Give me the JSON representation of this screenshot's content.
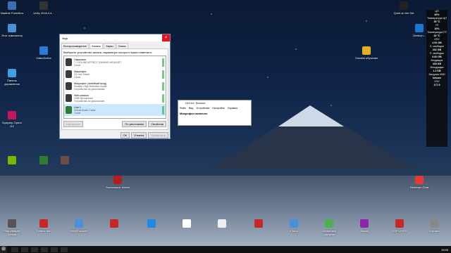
{
  "desktop": {
    "icons": [
      {
        "label": "Vladimir Pomelkov",
        "color": "#3b6fb5"
      },
      {
        "label": "Unity 2018.4.4...",
        "color": "#333"
      },
      {
        "label": "Этот компьютер",
        "color": "#4a90d9"
      },
      {
        "label": "VideoScribe",
        "color": "#2d7ad6"
      },
      {
        "label": "Панель управления",
        "color": "#3fa0e0"
      },
      {
        "label": "Браузер Opera GX",
        "color": "#c2185b"
      },
      {
        "label": "Quiet on the Set",
        "color": "#222"
      },
      {
        "label": "GeekUn...",
        "color": "#1976d2"
      },
      {
        "label": "Онлайн обучение",
        "color": "#e0b020"
      },
      {
        "label": "Soundstone Select",
        "color": "#b71c1c"
      },
      {
        "label": "Redream Chat",
        "color": "#e53935"
      }
    ],
    "taskbar_icons": [
      {
        "label": "Play Ultimate Deluxe",
        "color": "#555"
      },
      {
        "label": "Folders ban",
        "color": "#c62828"
      },
      {
        "label": "KeepFocused",
        "color": "#4a90d9"
      },
      {
        "label": "",
        "color": "#c62828"
      },
      {
        "label": "",
        "color": "#1e88e5"
      },
      {
        "label": "",
        "color": "#fff"
      },
      {
        "label": "",
        "color": "#c62828"
      },
      {
        "label": "iCloud",
        "color": "#4a90d9"
      },
      {
        "label": "GreenBack Launcher",
        "color": "#4caf50"
      },
      {
        "label": "Форму",
        "color": "#8e24aa"
      },
      {
        "label": "KOPLAYER",
        "color": "#c62828"
      },
      {
        "label": "Корзина",
        "color": "#888"
      }
    ]
  },
  "sound_dialog": {
    "title": "Звук",
    "close": "×",
    "tabs": [
      "Воспроизведение",
      "Запись",
      "Звуки",
      "Связь"
    ],
    "active_tab": 1,
    "hint": "Выберите устройство записи, параметры которого нужно изменить:",
    "devices": [
      {
        "name": "Наушники",
        "sub1": "7.1 SOUND EFFECT GAMING HEADSET",
        "sub2": "Готов",
        "selected": false
      },
      {
        "name": "Микрофон",
        "sub1": "G2 mic Street",
        "sub2": "Готов",
        "selected": false
      },
      {
        "name": "Микрофон (линейный вход)",
        "sub1": "Realtek High Definition Audio",
        "sub2": "Устройство по умолчанию",
        "selected": false
      },
      {
        "name": "Web-камера",
        "sub1": "USB Microphone",
        "sub2": "Устройство по умолчанию",
        "selected": false
      },
      {
        "name": "Line 1",
        "sub1": "Virtual Audio Cable",
        "sub2": "Готов",
        "selected": true
      }
    ],
    "configure_label": "Настроить",
    "default_label": "По умолчанию",
    "properties_label": "Свойства",
    "ok_label": "ОК",
    "cancel_label": "Отмена",
    "apply_label": "Применить"
  },
  "notepad": {
    "title": "GZ3.txt - Блокнот",
    "menu": [
      "Файл",
      "Вид",
      "Устройства",
      "Настройки",
      "Справка"
    ],
    "body": "Микрофон включен"
  },
  "sidebar": {
    "lines": [
      {
        "text": "ЦП",
        "hl": false
      },
      {
        "text": "40%",
        "hl": true
      },
      {
        "text": "Температура ЦП",
        "hl": false
      },
      {
        "text": "39 °C",
        "hl": true
      },
      {
        "text": "ГП",
        "hl": false
      },
      {
        "text": "10%",
        "hl": true
      },
      {
        "text": "Температура ГП",
        "hl": false
      },
      {
        "text": "32 °C",
        "hl": true
      },
      {
        "text": "ОЗУ",
        "hl": false
      },
      {
        "text": "4.92 GB",
        "hl": true
      },
      {
        "text": "С: свободно",
        "hl": false
      },
      {
        "text": "202 GB",
        "hl": true
      },
      {
        "text": "F: свободно",
        "hl": false
      },
      {
        "text": "9.60 GB",
        "hl": true
      },
      {
        "text": "Входящие",
        "hl": false
      },
      {
        "text": "433 KB",
        "hl": true
      },
      {
        "text": "Исходящие",
        "hl": false
      },
      {
        "text": "1.2 KB",
        "hl": true
      },
      {
        "text": "Загрузка HDD",
        "hl": false
      },
      {
        "text": "bdcam",
        "hl": true
      },
      {
        "text": "ОЗУ",
        "hl": false
      },
      {
        "text": "177.9",
        "hl": true
      }
    ]
  },
  "taskbar": {
    "start_glyph": "⊞",
    "clock": "19:55"
  }
}
